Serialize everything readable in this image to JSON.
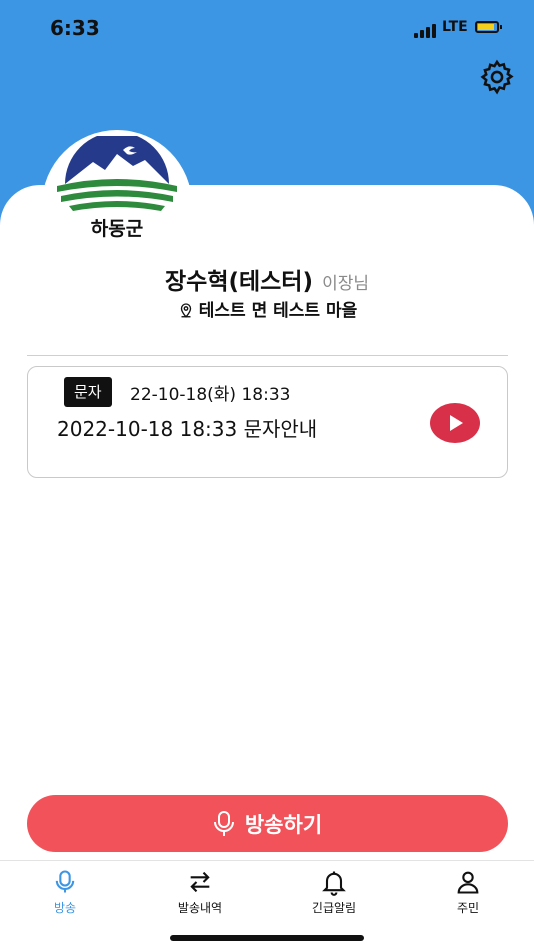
{
  "status_bar": {
    "time": "6:33",
    "network": "LTE"
  },
  "header": {
    "settings_icon": "gear-icon"
  },
  "logo": {
    "text": "하동군"
  },
  "user": {
    "name": "장수혁(테스터)",
    "role": "이장님",
    "location": "테스트 면 테스트 마을",
    "location_icon": "map-pin-icon"
  },
  "message": {
    "badge": "문자",
    "datetime": "22-10-18(화) 18:33",
    "title": "2022-10-18 18:33 문자안내",
    "play_icon": "play-icon"
  },
  "broadcast_button": {
    "label": "방송하기",
    "icon": "microphone-icon"
  },
  "tabs": [
    {
      "label": "방송",
      "icon": "microphone-icon",
      "active": true
    },
    {
      "label": "발송내역",
      "icon": "swap-arrows-icon",
      "active": false
    },
    {
      "label": "긴급알림",
      "icon": "bell-icon",
      "active": false
    },
    {
      "label": "주민",
      "icon": "person-icon",
      "active": false
    }
  ],
  "colors": {
    "header": "#3d96e3",
    "accent_red": "#f25259",
    "play_red": "#d9304a",
    "active_tab": "#3d96e3"
  }
}
